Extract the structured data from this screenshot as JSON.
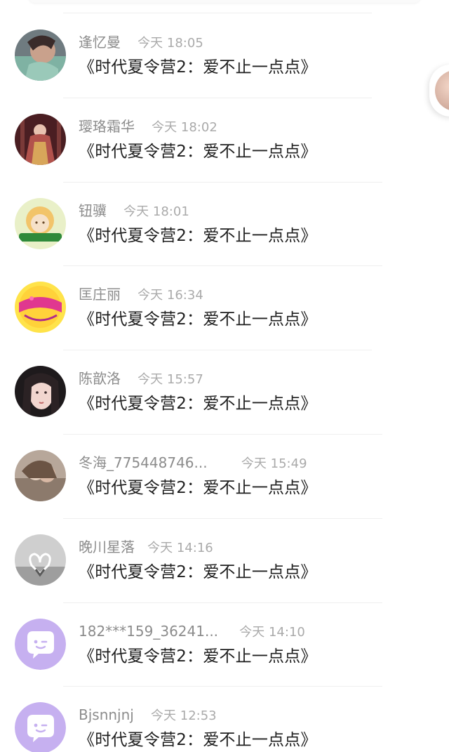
{
  "messages": [
    {
      "name": "逢忆曼",
      "time": "今天 18:05",
      "text": "《时代夏令营2：爱不止一点点》",
      "avatar": "photo-avatar"
    },
    {
      "name": "璎珞霜华",
      "time": "今天 18:02",
      "text": "《时代夏令营2：爱不止一点点》",
      "avatar": "photo-avatar"
    },
    {
      "name": "钮骥",
      "time": "今天 18:01",
      "text": "《时代夏令营2：爱不止一点点》",
      "avatar": "photo-avatar"
    },
    {
      "name": "匡庄丽",
      "time": "今天 16:34",
      "text": "《时代夏令营2：爱不止一点点》",
      "avatar": "photo-avatar"
    },
    {
      "name": "陈歆洛",
      "time": "今天 15:57",
      "text": "《时代夏令营2：爱不止一点点》",
      "avatar": "photo-avatar"
    },
    {
      "name": "冬海_775448746...",
      "time": "今天 15:49",
      "text": "《时代夏令营2：爱不止一点点》",
      "avatar": "photo-avatar"
    },
    {
      "name": "晚川星落",
      "time": "今天 14:16",
      "text": "《时代夏令营2：爱不止一点点》",
      "avatar": "photo-avatar"
    },
    {
      "name": "182***159_36241...",
      "time": "今天 14:10",
      "text": "《时代夏令营2：爱不止一点点》",
      "avatar": "default-chat-avatar-icon"
    },
    {
      "name": "Bjsnnjnj",
      "time": "今天 12:53",
      "text": "《时代夏令营2：爱不止一点点》",
      "avatar": "default-chat-avatar-icon"
    }
  ],
  "colors": {
    "default_avatar_bg": "#c6b0f0",
    "name_text": "#8c8c8c",
    "time_text": "#aaaaaa",
    "message_text": "#1f1f1f",
    "divider": "#efefef"
  }
}
